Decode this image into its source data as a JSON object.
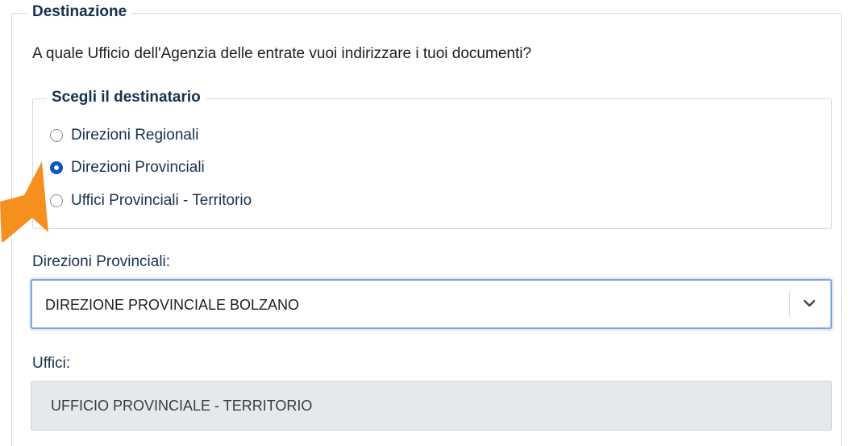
{
  "destination": {
    "legend": "Destinazione",
    "question": "A quale Ufficio dell'Agenzia delle entrate vuoi indirizzare i tuoi documenti?"
  },
  "recipient": {
    "legend": "Scegli il destinatario",
    "options": [
      {
        "label": "Direzioni Regionali",
        "checked": false
      },
      {
        "label": "Direzioni Provinciali",
        "checked": true
      },
      {
        "label": "Uffici Provinciali - Territorio",
        "checked": false
      }
    ]
  },
  "provincial": {
    "label": "Direzioni Provinciali:",
    "selected": "DIREZIONE PROVINCIALE BOLZANO"
  },
  "offices": {
    "label": "Uffici:",
    "value": "UFFICIO PROVINCIALE - TERRITORIO"
  },
  "colors": {
    "accent": "#0b57b8",
    "heading": "#17324d",
    "pointer": "#f5901e"
  },
  "icons": {
    "dropdown": "chevron-down-icon",
    "pointer": "arrow-pointer-icon"
  }
}
